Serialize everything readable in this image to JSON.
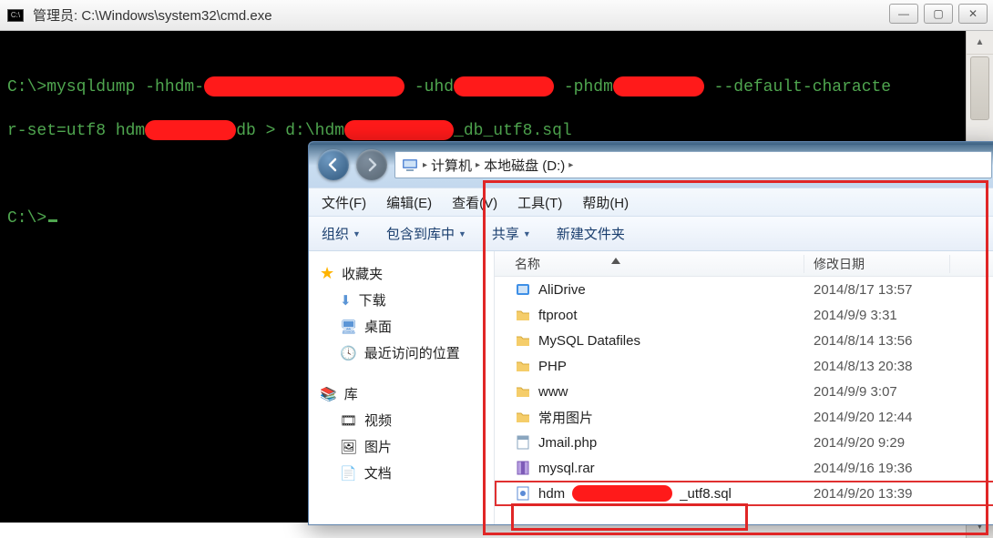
{
  "cmd": {
    "title": "管理员: C:\\Windows\\system32\\cmd.exe",
    "icon_label": "C:\\",
    "line1_a": "C:\\>mysqldump -hhdm-",
    "line1_b": " -uhd",
    "line1_c": " -phdm",
    "line1_d": " --default-characte",
    "line2_a": "r-set=utf8 hdm",
    "line2_b": "db > d:\\hdm",
    "line2_c": "_db_utf8.sql",
    "prompt": "C:\\>"
  },
  "explorer": {
    "breadcrumb": {
      "root": "计算机",
      "drive": "本地磁盘 (D:)"
    },
    "menu": {
      "file": "文件(F)",
      "edit": "编辑(E)",
      "view": "查看(V)",
      "tools": "工具(T)",
      "help": "帮助(H)"
    },
    "toolbar": {
      "organize": "组织",
      "include": "包含到库中",
      "share": "共享",
      "newfolder": "新建文件夹"
    },
    "sidebar": {
      "favorites": "收藏夹",
      "downloads": "下载",
      "desktop": "桌面",
      "recent": "最近访问的位置",
      "library": "库",
      "video": "视频",
      "pictures": "图片",
      "docs": "文档"
    },
    "columns": {
      "name": "名称",
      "date": "修改日期"
    },
    "files": [
      {
        "icon": "drive",
        "name": "AliDrive",
        "date": "2014/8/17 13:57"
      },
      {
        "icon": "folder",
        "name": "ftproot",
        "date": "2014/9/9 3:31"
      },
      {
        "icon": "folder",
        "name": "MySQL Datafiles",
        "date": "2014/8/14 13:56"
      },
      {
        "icon": "folder",
        "name": "PHP",
        "date": "2014/8/13 20:38"
      },
      {
        "icon": "folder",
        "name": "www",
        "date": "2014/9/9 3:07"
      },
      {
        "icon": "folder",
        "name": "常用图片",
        "date": "2014/9/20 12:44"
      },
      {
        "icon": "php",
        "name": "Jmail.php",
        "date": "2014/9/20 9:29"
      },
      {
        "icon": "rar",
        "name": "mysql.rar",
        "date": "2014/9/16 19:36"
      },
      {
        "icon": "sql",
        "name_a": "hdm",
        "name_b": "_utf8.sql",
        "date": "2014/9/20 13:39",
        "highlight": true
      }
    ]
  }
}
